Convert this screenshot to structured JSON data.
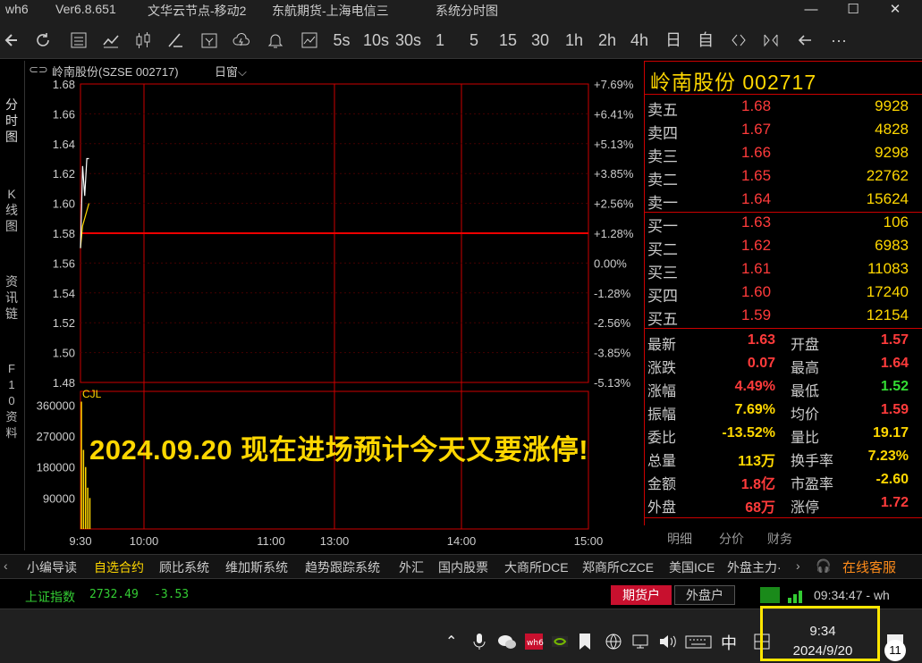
{
  "window": {
    "app": "wh6",
    "version": "Ver6.8.651",
    "server1": "文华云节点-移动2",
    "server2": "东航期货-上海电信三",
    "view": "系统分时图",
    "min": "—",
    "max": "☐",
    "close": "✕"
  },
  "toolbar": {
    "periods": [
      "5s",
      "10s",
      "30s",
      "1",
      "5",
      "15",
      "30",
      "1h",
      "2h",
      "4h",
      "日",
      "自"
    ],
    "more": "···"
  },
  "leftnav": {
    "items": [
      "分时图",
      "K线图",
      "资讯链",
      "F10资料"
    ]
  },
  "chart_head": {
    "name": "岭南股份(SZSE 002717)",
    "period": "日窗"
  },
  "chart_data": {
    "type": "line",
    "price_ticks": [
      "1.68",
      "1.66",
      "1.64",
      "1.62",
      "1.60",
      "1.58",
      "1.56",
      "1.54",
      "1.52",
      "1.50",
      "1.48"
    ],
    "pct_ticks": [
      "+7.69%",
      "+6.41%",
      "+5.13%",
      "+3.85%",
      "+2.56%",
      "+1.28%",
      "0.00%",
      "-1.28%",
      "-2.56%",
      "-3.85%",
      "-5.13%"
    ],
    "volume_label": "CJL",
    "volume_ticks": [
      "360000",
      "270000",
      "180000",
      "90000"
    ],
    "x_ticks": [
      "9:30",
      "10:00",
      "11:00",
      "13:00",
      "14:00",
      "15:00"
    ],
    "ylim": [
      1.48,
      1.68
    ],
    "prev_close": 1.58,
    "price": [
      {
        "t": "9:30",
        "v": 1.57
      },
      {
        "t": "9:31",
        "v": 1.625
      },
      {
        "t": "9:32",
        "v": 1.605
      },
      {
        "t": "9:33",
        "v": 1.63
      },
      {
        "t": "9:34",
        "v": 1.63
      }
    ],
    "avg": [
      {
        "t": "9:30",
        "v": 1.57
      },
      {
        "t": "9:31",
        "v": 1.585
      },
      {
        "t": "9:32",
        "v": 1.59
      },
      {
        "t": "9:33",
        "v": 1.595
      },
      {
        "t": "9:34",
        "v": 1.6
      }
    ],
    "volume": [
      {
        "t": "9:30",
        "v": 370000
      },
      {
        "t": "9:31",
        "v": 230000
      },
      {
        "t": "9:32",
        "v": 180000
      },
      {
        "t": "9:33",
        "v": 120000
      },
      {
        "t": "9:34",
        "v": 90000
      }
    ]
  },
  "quote": {
    "title": "岭南股份  002717",
    "asks": [
      {
        "label": "卖五",
        "price": "1.68",
        "vol": "9928"
      },
      {
        "label": "卖四",
        "price": "1.67",
        "vol": "4828"
      },
      {
        "label": "卖三",
        "price": "1.66",
        "vol": "9298"
      },
      {
        "label": "卖二",
        "price": "1.65",
        "vol": "22762"
      },
      {
        "label": "卖一",
        "price": "1.64",
        "vol": "15624"
      }
    ],
    "bids": [
      {
        "label": "买一",
        "price": "1.63",
        "vol": "106"
      },
      {
        "label": "买二",
        "price": "1.62",
        "vol": "6983"
      },
      {
        "label": "买三",
        "price": "1.61",
        "vol": "11083"
      },
      {
        "label": "买四",
        "price": "1.60",
        "vol": "17240"
      },
      {
        "label": "买五",
        "price": "1.59",
        "vol": "12154"
      }
    ],
    "stats": [
      {
        "l1": "最新",
        "v1": "1.63",
        "c1": "#ff3b3b",
        "l2": "开盘",
        "v2": "1.57",
        "c2": "#ff3b3b"
      },
      {
        "l1": "涨跌",
        "v1": "0.07",
        "c1": "#ff3b3b",
        "l2": "最高",
        "v2": "1.64",
        "c2": "#ff3b3b"
      },
      {
        "l1": "涨幅",
        "v1": "4.49%",
        "c1": "#ff3b3b",
        "l2": "最低",
        "v2": "1.52",
        "c2": "#33dd33"
      },
      {
        "l1": "振幅",
        "v1": "7.69%",
        "c1": "#ffd700",
        "l2": "均价",
        "v2": "1.59",
        "c2": "#ff3b3b"
      },
      {
        "l1": "委比",
        "v1": "-13.52%",
        "c1": "#ffd700",
        "l2": "量比",
        "v2": "19.17",
        "c2": "#ffd700"
      },
      {
        "l1": "总量",
        "v1": "113万",
        "c1": "#ffd700",
        "l2": "换手率",
        "v2": "7.23%",
        "c2": "#ffd700"
      },
      {
        "l1": "金额",
        "v1": "1.8亿",
        "c1": "#ff3b3b",
        "l2": "市盈率",
        "v2": "-2.60",
        "c2": "#ffd700"
      },
      {
        "l1": "外盘",
        "v1": "68万",
        "c1": "#ff3b3b",
        "l2": "涨停",
        "v2": "1.72",
        "c2": "#ff3b3b"
      }
    ],
    "tabs": [
      "明细",
      "分价",
      "财务"
    ]
  },
  "overlay_text": "2024.09.20 现在进场预计今天又要涨停!",
  "modules": {
    "items": [
      "小编导读",
      "自选合约",
      "顾比系统",
      "维加斯系统",
      "趋势跟踪系统",
      "外汇",
      "国内股票",
      "大商所DCE",
      "郑商所CZCE",
      "美国ICE",
      "外盘主力·"
    ],
    "service": "在线客服"
  },
  "status": {
    "index_name": "上证指数",
    "index_value": "2732.49",
    "index_change": "-3.53",
    "futures_account": "期货户",
    "foreign_account": "外盘户",
    "time": "09:34:47 - wh"
  },
  "taskbar": {
    "ime": "中",
    "clock_time": "9:34",
    "clock_date": "2024/9/20",
    "notif_count": "11"
  }
}
